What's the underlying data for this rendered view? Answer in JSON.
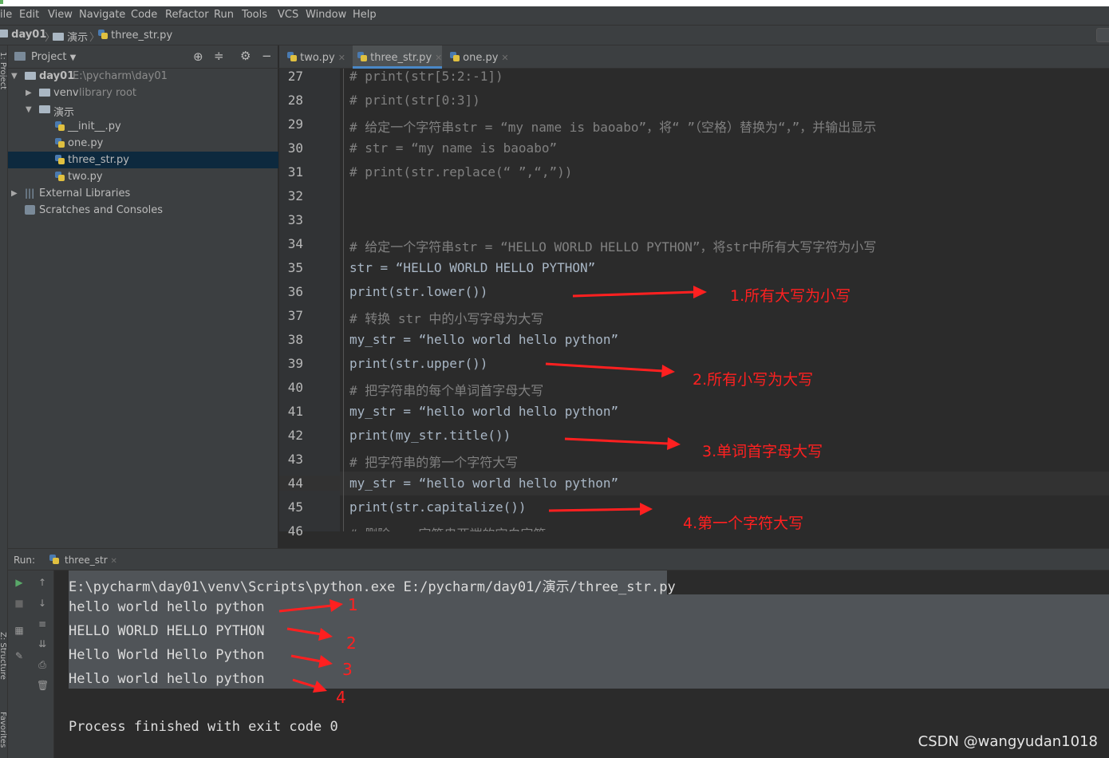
{
  "menubar": {
    "items": [
      "ile",
      "Edit",
      "View",
      "Navigate",
      "Code",
      "Refactor",
      "Run",
      "Tools",
      "VCS",
      "Window",
      "Help"
    ]
  },
  "breadcrumb": [
    "day01",
    "演示",
    "three_str.py"
  ],
  "project": {
    "header_label": "Project",
    "side_label": "1: Project",
    "tree": [
      {
        "label": "day01",
        "extra": "E:\\pycharm\\day01"
      },
      {
        "label": "venv",
        "extra": "library root"
      },
      {
        "label": "演示",
        "extra": ""
      },
      {
        "label": "__init__.py",
        "extra": ""
      },
      {
        "label": "one.py",
        "extra": ""
      },
      {
        "label": "three_str.py",
        "extra": ""
      },
      {
        "label": "two.py",
        "extra": ""
      },
      {
        "label": "External Libraries",
        "extra": ""
      },
      {
        "label": "Scratches and Consoles",
        "extra": ""
      }
    ]
  },
  "tabs": [
    "two.py",
    "three_str.py",
    "one.py"
  ],
  "editor": {
    "line_numbers": [
      "27",
      "28",
      "29",
      "30",
      "31",
      "32",
      "33",
      "34",
      "35",
      "36",
      "37",
      "38",
      "39",
      "40",
      "41",
      "42",
      "43",
      "44",
      "45",
      "46"
    ],
    "lines": [
      "# print(str[5:2:-1])",
      "# print(str[0:3])",
      "# 给定一个字符串str = “my name is baoabo”，将“ ”（空格）替换为“，”，并输出显示",
      "# str = “my name is baoabo”",
      "# print(str.replace(“ ”,“,”))",
      "",
      "",
      "# 给定一个字符串str = “HELLO WORLD HELLO PYTHON”，将str中所有大写字符为小写",
      "str = “HELLO WORLD HELLO PYTHON”",
      "print(str.lower())",
      "# 转换 str 中的小写字母为大写",
      "my_str = “hello world hello python”",
      "print(str.upper())",
      "# 把字符串的每个单词首字母大写",
      "my_str = “hello world hello python”",
      "print(my_str.title())",
      "# 把字符串的第一个字符大写",
      "my_str = “hello world hello python”",
      "print(str.capitalize())",
      "# 删除 ， 字符串两端的空白字符"
    ],
    "annotations": [
      "1.所有大写为小写",
      "2.所有小写为大写",
      "3.单词首字母大写",
      "4.第一个字符大写"
    ]
  },
  "run": {
    "label": "Run:",
    "tab": "three_str",
    "side_label_1": "Z: Structure",
    "side_label_2": "Favorites",
    "output": [
      "E:\\pycharm\\day01\\venv\\Scripts\\python.exe E:/pycharm/day01/演示/three_str.py",
      "hello world hello python",
      "HELLO WORLD HELLO PYTHON",
      "Hello World Hello Python",
      "Hello world hello python",
      "",
      "Process finished with exit code 0"
    ],
    "annotations": [
      "1",
      "2",
      "3",
      "4"
    ]
  },
  "watermark": "CSDN @wangyudan1018",
  "colors": {
    "comment": "#808080",
    "string": "#e8d9a0",
    "annotation": "#ff2020",
    "selection": "#0d293e"
  }
}
